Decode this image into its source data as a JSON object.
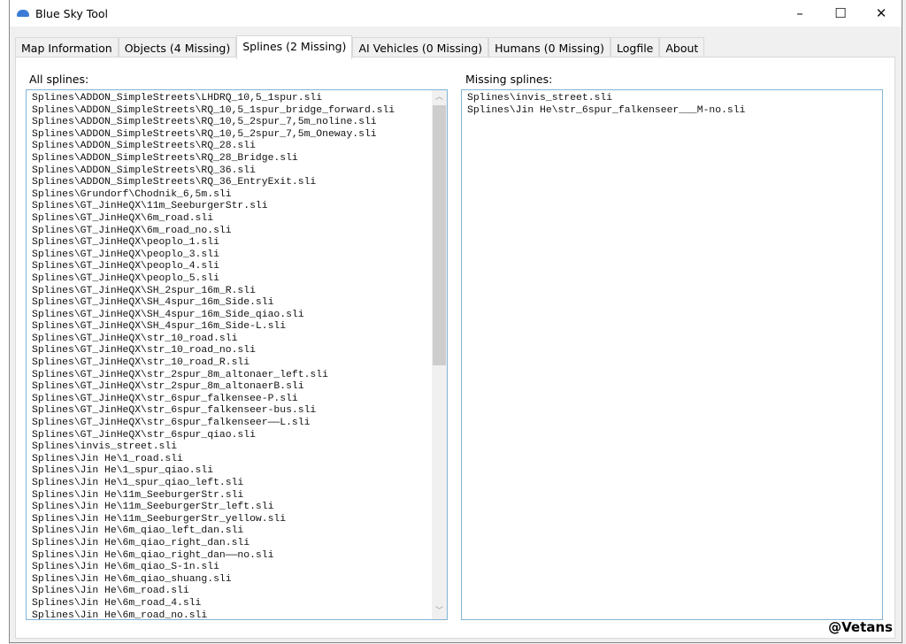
{
  "window": {
    "title": "Blue Sky Tool",
    "controls": [
      "–",
      "☐",
      "✕"
    ]
  },
  "tabs": [
    {
      "label": "Map Information",
      "active": false
    },
    {
      "label": "Objects (4 Missing)",
      "active": false
    },
    {
      "label": "Splines (2 Missing)",
      "active": true
    },
    {
      "label": "AI Vehicles (0 Missing)",
      "active": false
    },
    {
      "label": "Humans (0 Missing)",
      "active": false
    },
    {
      "label": "Logfile",
      "active": false
    },
    {
      "label": "About",
      "active": false
    }
  ],
  "all_splines": {
    "label": "All splines:",
    "items": [
      "Splines\\ADDON_SimpleStreets\\LHDRQ_10,5_1spur.sli",
      "Splines\\ADDON_SimpleStreets\\RQ_10,5_1spur_bridge_forward.sli",
      "Splines\\ADDON_SimpleStreets\\RQ_10,5_2spur_7,5m_noline.sli",
      "Splines\\ADDON_SimpleStreets\\RQ_10,5_2spur_7,5m_Oneway.sli",
      "Splines\\ADDON_SimpleStreets\\RQ_28.sli",
      "Splines\\ADDON_SimpleStreets\\RQ_28_Bridge.sli",
      "Splines\\ADDON_SimpleStreets\\RQ_36.sli",
      "Splines\\ADDON_SimpleStreets\\RQ_36_EntryExit.sli",
      "Splines\\Grundorf\\Chodnik_6,5m.sli",
      "Splines\\GT_JinHeQX\\11m_SeeburgerStr.sli",
      "Splines\\GT_JinHeQX\\6m_road.sli",
      "Splines\\GT_JinHeQX\\6m_road_no.sli",
      "Splines\\GT_JinHeQX\\peoplo_1.sli",
      "Splines\\GT_JinHeQX\\peoplo_3.sli",
      "Splines\\GT_JinHeQX\\peoplo_4.sli",
      "Splines\\GT_JinHeQX\\peoplo_5.sli",
      "Splines\\GT_JinHeQX\\SH_2spur_16m_R.sli",
      "Splines\\GT_JinHeQX\\SH_4spur_16m_Side.sli",
      "Splines\\GT_JinHeQX\\SH_4spur_16m_Side_qiao.sli",
      "Splines\\GT_JinHeQX\\SH_4spur_16m_Side-L.sli",
      "Splines\\GT_JinHeQX\\str_10_road.sli",
      "Splines\\GT_JinHeQX\\str_10_road_no.sli",
      "Splines\\GT_JinHeQX\\str_10_road_R.sli",
      "Splines\\GT_JinHeQX\\str_2spur_8m_altonaer_left.sli",
      "Splines\\GT_JinHeQX\\str_2spur_8m_altonaerB.sli",
      "Splines\\GT_JinHeQX\\str_6spur_falkensee-P.sli",
      "Splines\\GT_JinHeQX\\str_6spur_falkenseer-bus.sli",
      "Splines\\GT_JinHeQX\\str_6spur_falkenseer——L.sli",
      "Splines\\GT_JinHeQX\\str_6spur_qiao.sli",
      "Splines\\invis_street.sli",
      "Splines\\Jin He\\1_road.sli",
      "Splines\\Jin He\\1_spur_qiao.sli",
      "Splines\\Jin He\\1_spur_qiao_left.sli",
      "Splines\\Jin He\\11m_SeeburgerStr.sli",
      "Splines\\Jin He\\11m_SeeburgerStr_left.sli",
      "Splines\\Jin He\\11m_SeeburgerStr_yellow.sli",
      "Splines\\Jin He\\6m_qiao_left_dan.sli",
      "Splines\\Jin He\\6m_qiao_right_dan.sli",
      "Splines\\Jin He\\6m_qiao_right_dan——no.sli",
      "Splines\\Jin He\\6m_qiao_S-1n.sli",
      "Splines\\Jin He\\6m_qiao_shuang.sli",
      "Splines\\Jin He\\6m_road.sli",
      "Splines\\Jin He\\6m_road_4.sli",
      "Splines\\Jin He\\6m_road_no.sli"
    ]
  },
  "missing_splines": {
    "label": "Missing splines:",
    "items": [
      "Splines\\invis_street.sli",
      "Splines\\Jin He\\str_6spur_falkenseer___M-no.sli"
    ]
  },
  "watermark": "@Vetans"
}
